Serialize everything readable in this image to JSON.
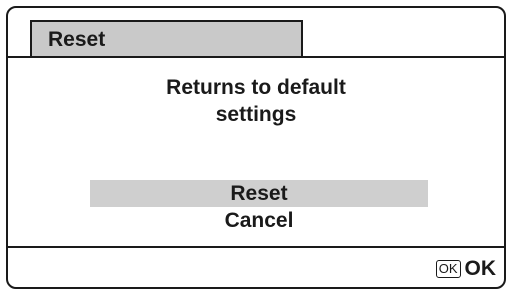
{
  "header": {
    "tab_label": "Reset"
  },
  "message": {
    "line1": "Returns to default",
    "line2": "settings"
  },
  "options": {
    "reset": "Reset",
    "cancel": "Cancel",
    "selected": "Reset"
  },
  "footer": {
    "ok_icon": "OK",
    "ok_label": "OK"
  },
  "colors": {
    "highlight": "#cfcfcf",
    "tab": "#c9c9c9",
    "text": "#1a1a1a"
  }
}
